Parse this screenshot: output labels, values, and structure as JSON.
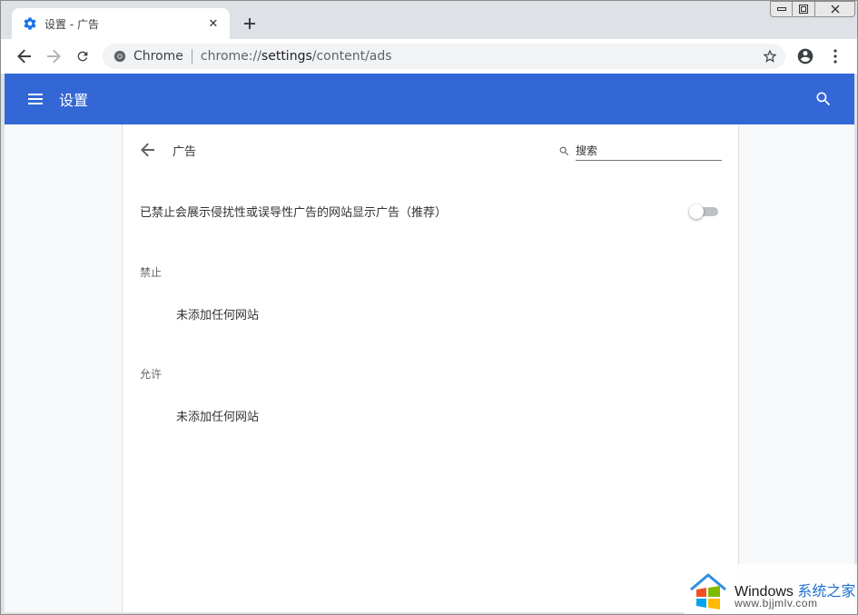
{
  "tab": {
    "title": "设置 - 广告",
    "close_glyph": "✕"
  },
  "toolbar": {
    "site_label": "Chrome",
    "url_prefix": "chrome://",
    "url_host": "settings",
    "url_path": "/content/ads"
  },
  "appbar": {
    "title": "设置"
  },
  "subpage": {
    "title": "广告",
    "search_placeholder": "搜索"
  },
  "ads_toggle": {
    "label": "已禁止会展示侵扰性或误导性广告的网站显示广告（推荐）",
    "enabled": false
  },
  "sections": {
    "blocked_title": "禁止",
    "blocked_empty": "未添加任何网站",
    "allowed_title": "允许",
    "allowed_empty": "未添加任何网站"
  },
  "watermark": {
    "brand": "Windows",
    "brand_cn": "系统之家",
    "site": "www.bjjmlv.com"
  },
  "colors": {
    "accent": "#3367d6",
    "tab_strip": "#dee1e6",
    "content_bg": "#f8f9fa"
  }
}
